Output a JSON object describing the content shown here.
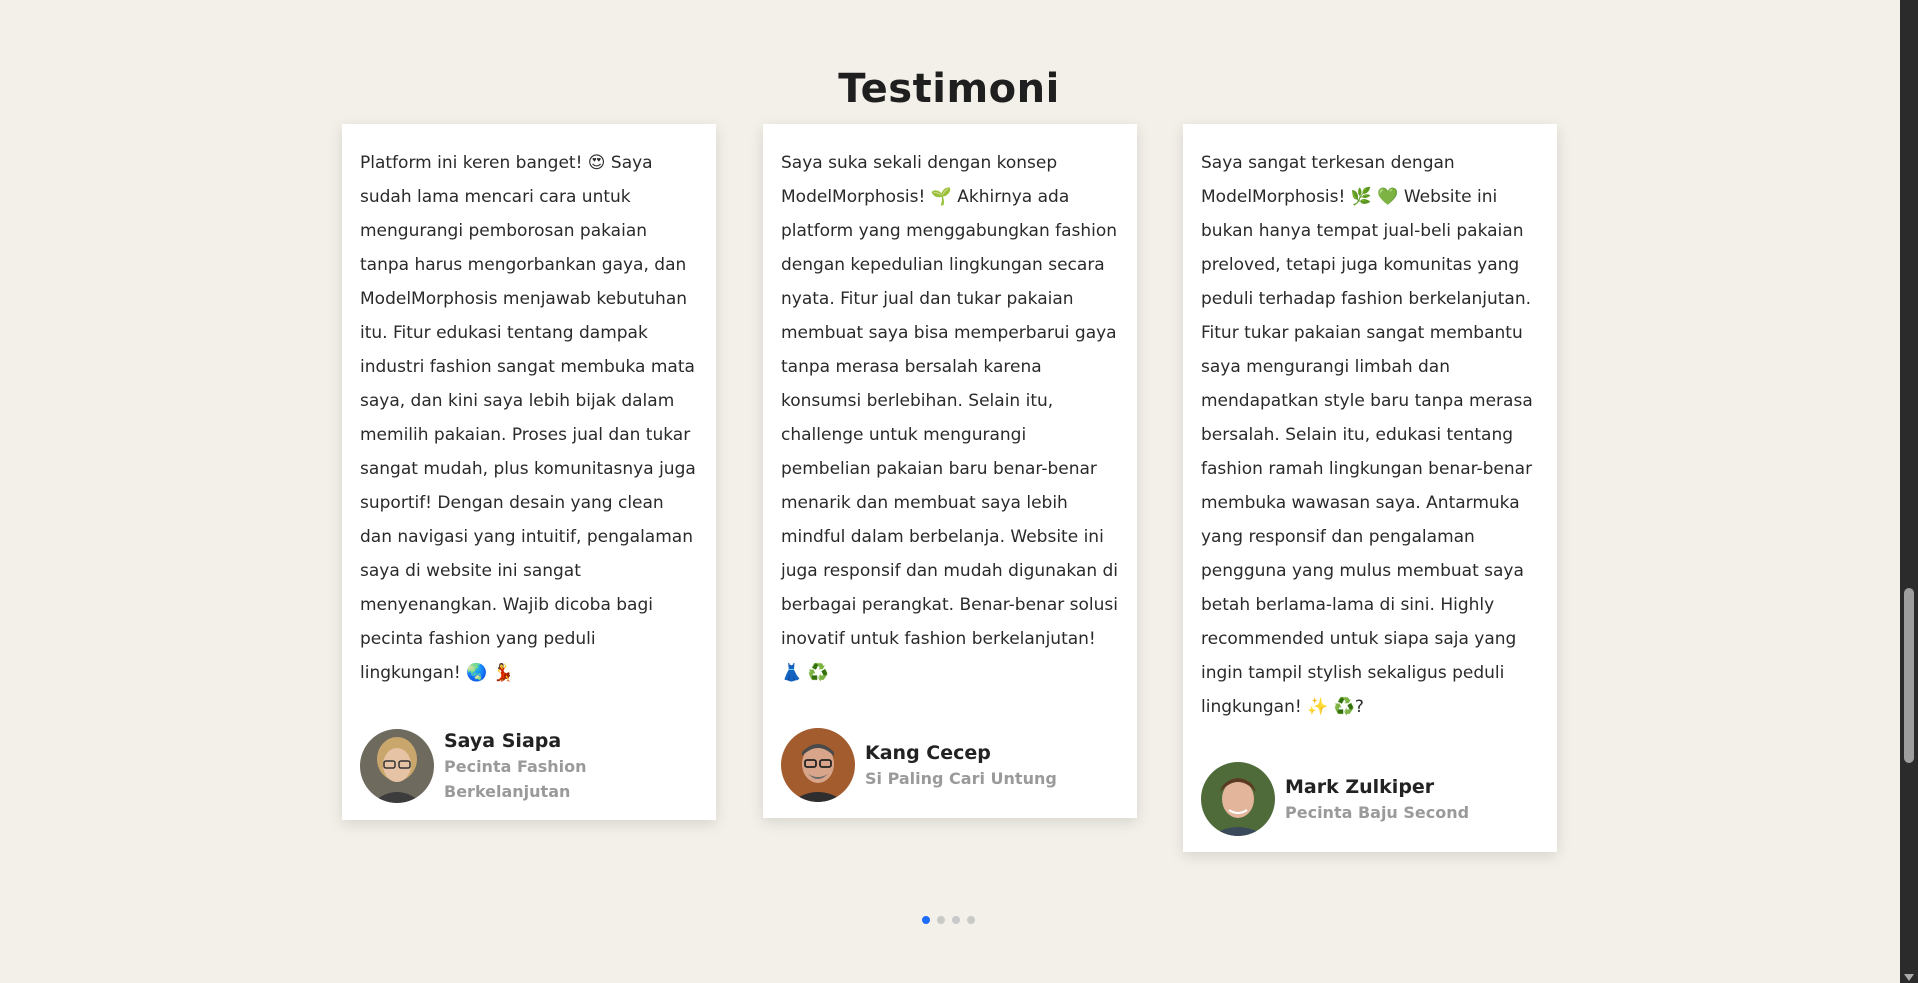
{
  "section": {
    "title": "Testimoni"
  },
  "testimonials": [
    {
      "text": "Platform ini keren banget! 😍 Saya sudah lama mencari cara untuk mengurangi pemborosan pakaian tanpa harus mengorbankan gaya, dan ModelMorphosis menjawab kebutuhan itu. Fitur edukasi tentang dampak industri fashion sangat membuka mata saya, dan kini saya lebih bijak dalam memilih pakaian. Proses jual dan tukar sangat mudah, plus komunitasnya juga suportif! Dengan desain yang clean dan navigasi yang intuitif, pengalaman saya di website ini sangat menyenangkan. Wajib dicoba bagi pecinta fashion yang peduli lingkungan! 🌏 💃",
      "name": "Saya Siapa",
      "role": "Pecinta Fashion Berkelanjutan"
    },
    {
      "text": "Saya suka sekali dengan konsep ModelMorphosis! 🌱 Akhirnya ada platform yang menggabungkan fashion dengan kepedulian lingkungan secara nyata. Fitur jual dan tukar pakaian membuat saya bisa memperbarui gaya tanpa merasa bersalah karena konsumsi berlebihan. Selain itu, challenge untuk mengurangi pembelian pakaian baru benar-benar menarik dan membuat saya lebih mindful dalam berbelanja. Website ini juga responsif dan mudah digunakan di berbagai perangkat. Benar-benar solusi inovatif untuk fashion berkelanjutan! 👗 ♻️",
      "name": "Kang Cecep",
      "role": "Si Paling Cari Untung"
    },
    {
      "text": "Saya sangat terkesan dengan ModelMorphosis! 🌿 💚 Website ini bukan hanya tempat jual-beli pakaian preloved, tetapi juga komunitas yang peduli terhadap fashion berkelanjutan. Fitur tukar pakaian sangat membantu saya mengurangi limbah dan mendapatkan style baru tanpa merasa bersalah. Selain itu, edukasi tentang fashion ramah lingkungan benar-benar membuka wawasan saya. Antarmuka yang responsif dan pengalaman pengguna yang mulus membuat saya betah berlama-lama di sini. Highly recommended untuk siapa saja yang ingin tampil stylish sekaligus peduli lingkungan! ✨ ♻️?",
      "name": "Mark Zulkiper",
      "role": "Pecinta Baju Second"
    }
  ],
  "carousel": {
    "active_index": 0,
    "count": 4
  },
  "colors": {
    "background": "#f3f0e9",
    "dot_active": "#1e6bff",
    "dot_inactive": "#c9c9c9"
  }
}
